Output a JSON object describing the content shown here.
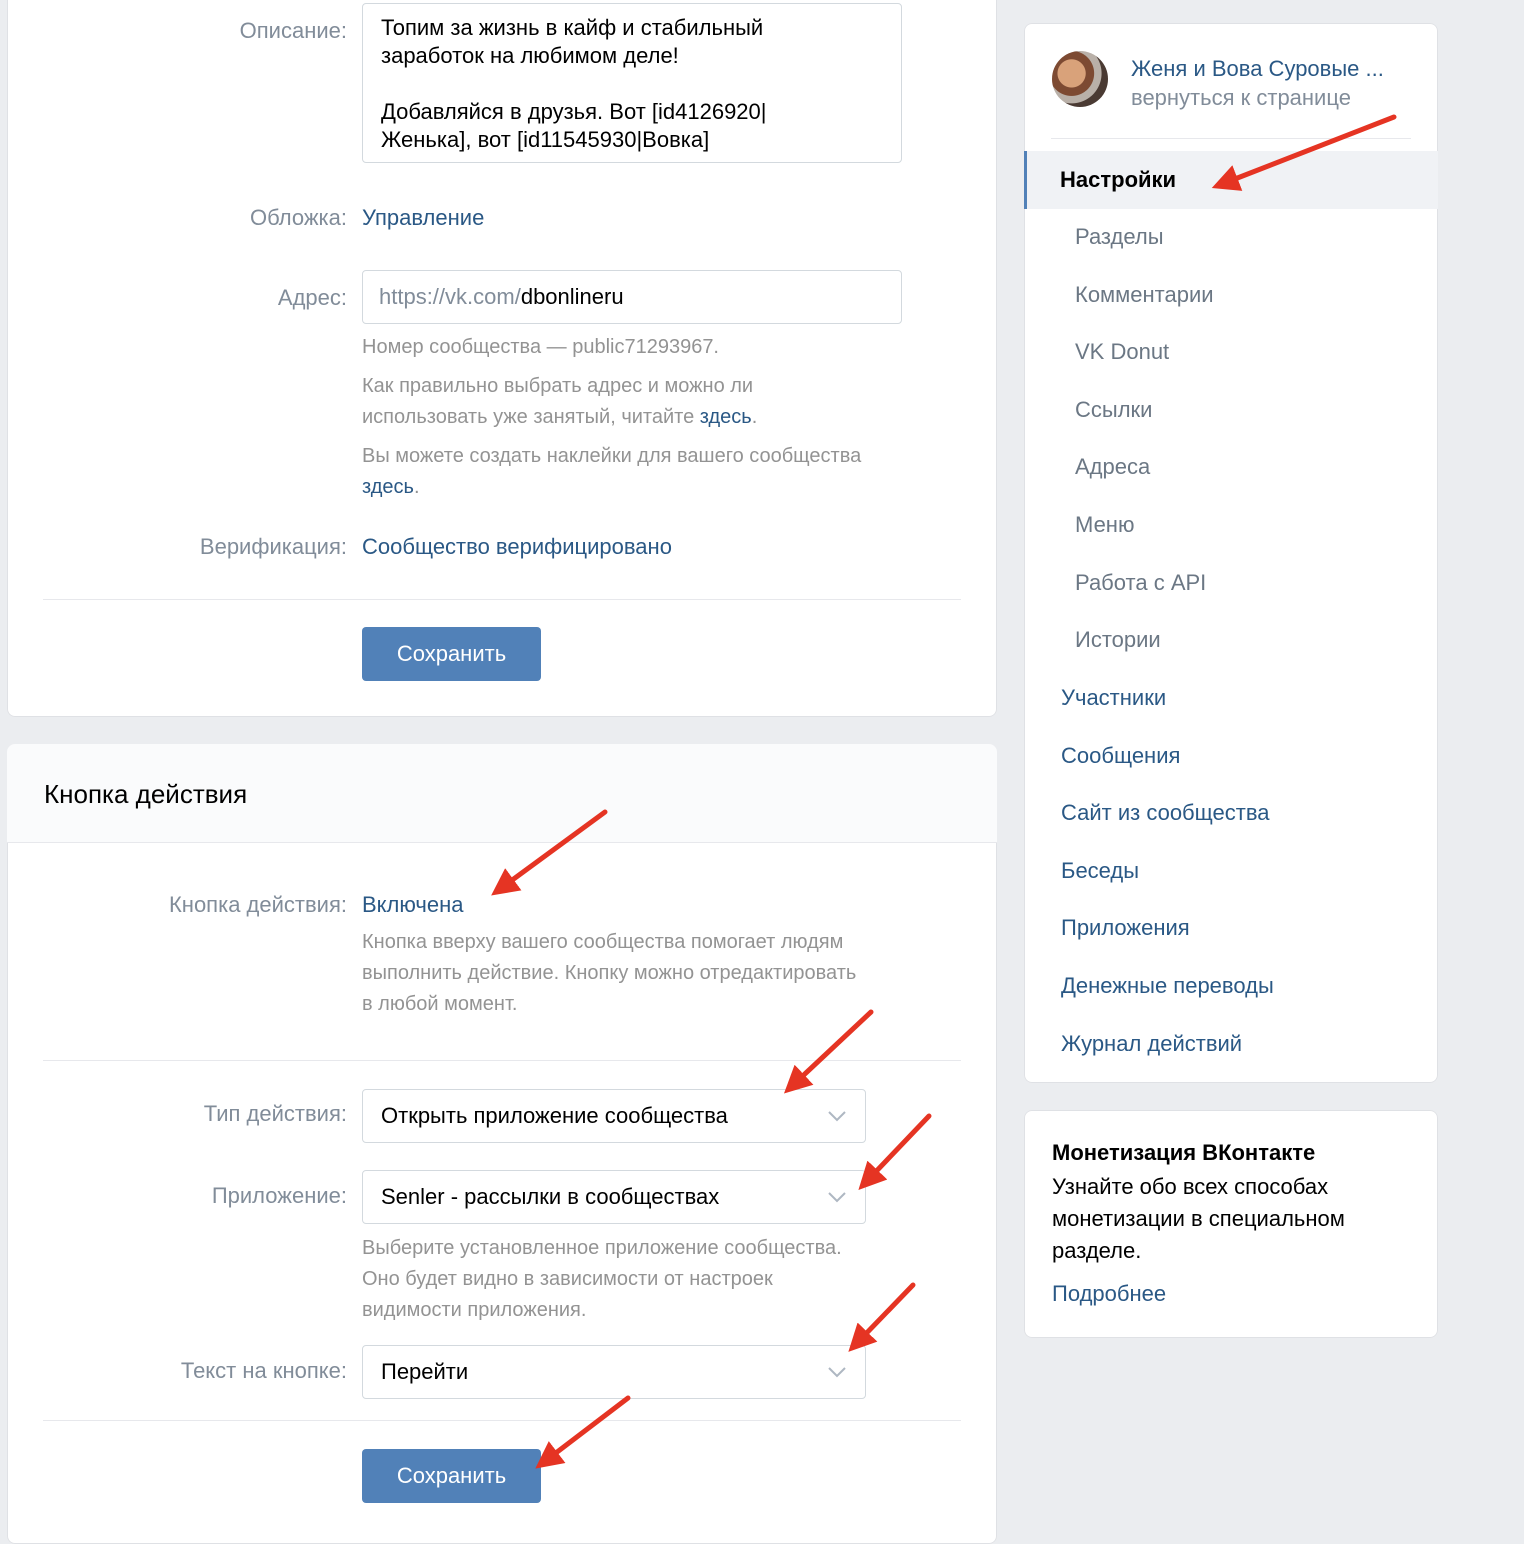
{
  "colors": {
    "accent": "#5181b8",
    "link": "#2a5885",
    "arrow": "#e53423",
    "background": "#ebedf0"
  },
  "main": {
    "description": {
      "label": "Описание:",
      "value_line1": "Топим за жизнь в кайф и стабильный",
      "value_line2": "заработок на любимом деле!",
      "value_line3": "Добавляйся в друзья. Вот [id4126920|",
      "value_line4": "Женька], вот [id11545930|Вовка]"
    },
    "cover": {
      "label": "Обложка:",
      "link": "Управление"
    },
    "address": {
      "label": "Адрес:",
      "prefix": "https://vk.com/",
      "value": "dbonlineru",
      "number_hint": "Номер сообщества — public71293967.",
      "how_hint_line1": "Как правильно выбрать адрес и можно ли",
      "how_hint_line2": "использовать уже занятый, читайте",
      "how_link": "здесь",
      "sticker_hint_line1": "Вы можете создать наклейки для вашего сообщества",
      "sticker_link": "здесь"
    },
    "verification": {
      "label": "Верификация:",
      "value": "Сообщество верифицировано"
    },
    "save_label": "Сохранить"
  },
  "action_button": {
    "title": "Кнопка действия",
    "status_label": "Кнопка действия:",
    "status_value": "Включена",
    "status_hint_line1": "Кнопка вверху вашего сообщества помогает людям",
    "status_hint_line2": "выполнить действие. Кнопку можно отредактировать",
    "status_hint_line3": "в любой момент.",
    "type_label": "Тип действия:",
    "type_value": "Открыть приложение сообщества",
    "app_label": "Приложение:",
    "app_value": "Senler - рассылки в сообществах",
    "app_hint_line1": "Выберите установленное приложение сообщества.",
    "app_hint_line2": "Оно будет видно в зависимости от настроек",
    "app_hint_line3": "видимости приложения.",
    "text_label": "Текст на кнопке:",
    "text_value": "Перейти",
    "save_label": "Сохранить"
  },
  "sidebar": {
    "community_name": "Женя и Вова Суровые ...",
    "back_link": "вернуться к странице",
    "active_item": "Настройки",
    "sub_items": [
      "Разделы",
      "Комментарии",
      "VK Donut",
      "Ссылки",
      "Адреса",
      "Меню",
      "Работа с API",
      "Истории"
    ],
    "items": [
      "Участники",
      "Сообщения",
      "Сайт из сообщества",
      "Беседы",
      "Приложения",
      "Денежные переводы",
      "Журнал действий"
    ]
  },
  "promo": {
    "title": "Монетизация ВКонтакте",
    "text_line1": "Узнайте обо всех способах",
    "text_line2": "монетизации в специальном",
    "text_line3": "разделе.",
    "link": "Подробнее"
  }
}
